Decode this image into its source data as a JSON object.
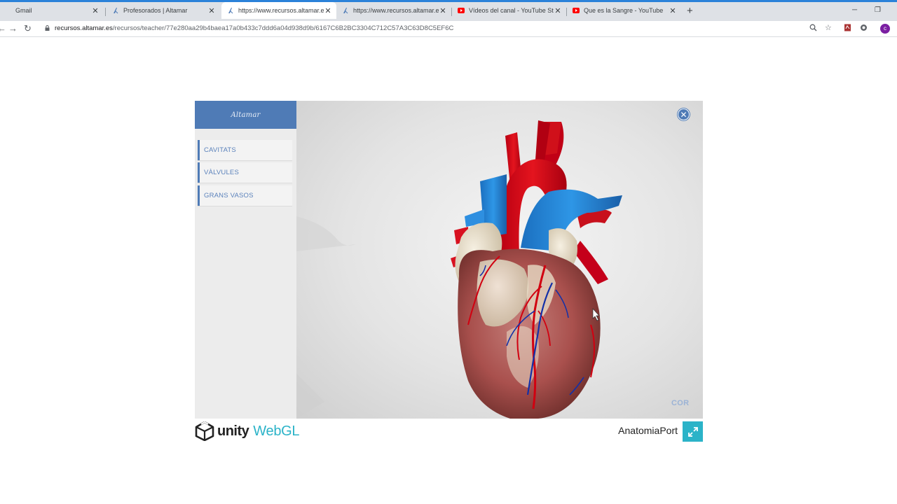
{
  "browser": {
    "tabs": [
      {
        "title": "Gmail",
        "active": false
      },
      {
        "title": "Profesorados | Altamar",
        "active": false
      },
      {
        "title": "https://www.recursos.altamar.es/",
        "active": true
      },
      {
        "title": "https://www.recursos.altamar.es/",
        "active": false
      },
      {
        "title": "Vídeos del canal - YouTube Studi",
        "active": false
      },
      {
        "title": "Que es la Sangre - YouTube",
        "active": false
      }
    ],
    "url_host": "recursos.altamar.es",
    "url_path": "/recursos/teacher/77e280aa29b4baea17a0b433c7ddd6a04d938d9b/6167C6B2BC3304C712C57A3C63D8C5EF6C",
    "profile_initial": "c"
  },
  "app": {
    "logo_text": "Altamar",
    "menu": [
      {
        "label": "CAVITATS"
      },
      {
        "label": "VÀLVULES"
      },
      {
        "label": "GRANS VASOS"
      }
    ],
    "view_label": "COR",
    "colors": {
      "brand_blue": "#4f7bb6",
      "menu_text": "#5b82bb",
      "unity_teal": "#2bb3c8"
    }
  },
  "footer": {
    "unity_text": "unity",
    "webgl_text": "WebGL",
    "product_name": "AnatomiaPort"
  }
}
